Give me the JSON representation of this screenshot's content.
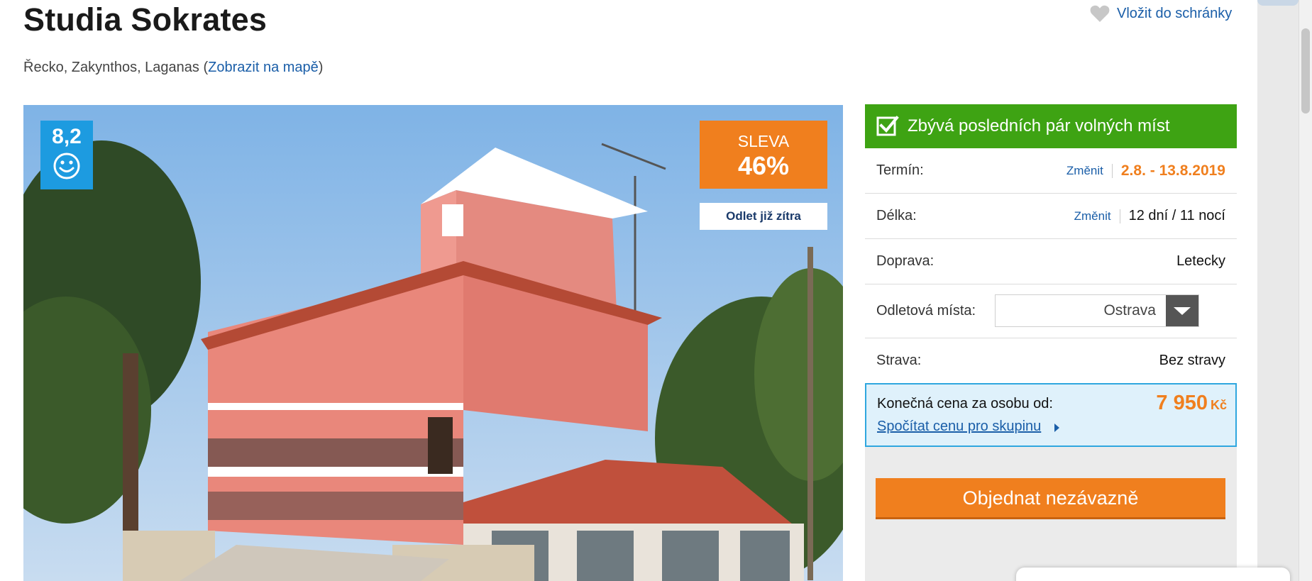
{
  "hotel": {
    "name": "Studia Sokrates",
    "location_prefix": "Řecko, Zakynthos, Laganas (",
    "map_link": "Zobrazit na mapě",
    "location_suffix": ")"
  },
  "favorite": {
    "label": "Vložit do schránky",
    "icon": "heart-icon"
  },
  "photo": {
    "rating": "8,2",
    "rating_icon": "smiley-icon",
    "discount_label": "SLEVA",
    "discount_value": "46%",
    "departure_badge": "Odlet již zítra"
  },
  "booking": {
    "availability": "Zbývá posledních pár volných míst",
    "availability_icon": "checkbox-checked-icon",
    "term_label": "Termín:",
    "term_change": "Změnit",
    "term_value": "2.8. - 13.8.2019",
    "length_label": "Délka:",
    "length_change": "Změnit",
    "length_value": "12 dní / 11 nocí",
    "transport_label": "Doprava:",
    "transport_value": "Letecky",
    "departure_label": "Odletová místa:",
    "departure_value": "Ostrava",
    "board_label": "Strava:",
    "board_value": "Bez stravy",
    "price_label": "Konečná cena za osobu od:",
    "group_link": "Spočítat cenu pro skupinu",
    "price_value": "7 950",
    "price_currency": "Kč",
    "order_button": "Objednat nezávazně"
  },
  "colors": {
    "accent_orange": "#f07f1e",
    "green": "#3ea313",
    "link_blue": "#1a5ea8",
    "rating_blue": "#1d9be0"
  }
}
